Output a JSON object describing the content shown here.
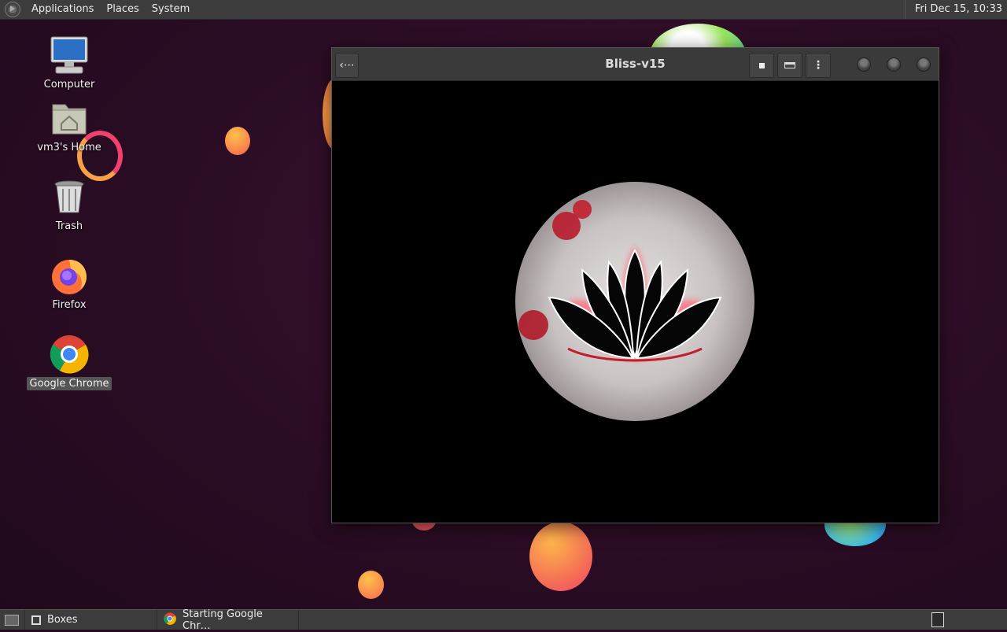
{
  "top_panel": {
    "menus": [
      "Applications",
      "Places",
      "System"
    ],
    "clock": "Fri Dec 15, 10:33"
  },
  "desktop": {
    "icons": [
      {
        "label": "Computer",
        "icon": "computer-icon"
      },
      {
        "label": "vm3's Home",
        "icon": "home-folder-icon"
      },
      {
        "label": "Trash",
        "icon": "trash-icon"
      },
      {
        "label": "Firefox",
        "icon": "firefox-icon"
      },
      {
        "label": "Google Chrome",
        "icon": "chrome-icon",
        "selected": true
      }
    ]
  },
  "window": {
    "title": "Bliss-v15",
    "buttons": [
      "back-icon",
      "stop-icon",
      "keyboard-icon",
      "menu-icon"
    ]
  },
  "bottom_panel": {
    "tasks": [
      {
        "label": "Boxes",
        "icon": "boxes-icon"
      },
      {
        "label": "Starting Google Chr…",
        "icon": "chrome-icon"
      }
    ]
  },
  "colors": {
    "accent_orange": "#f7a046",
    "accent_pink": "#f0416e",
    "panel": "#3c3c3c"
  }
}
